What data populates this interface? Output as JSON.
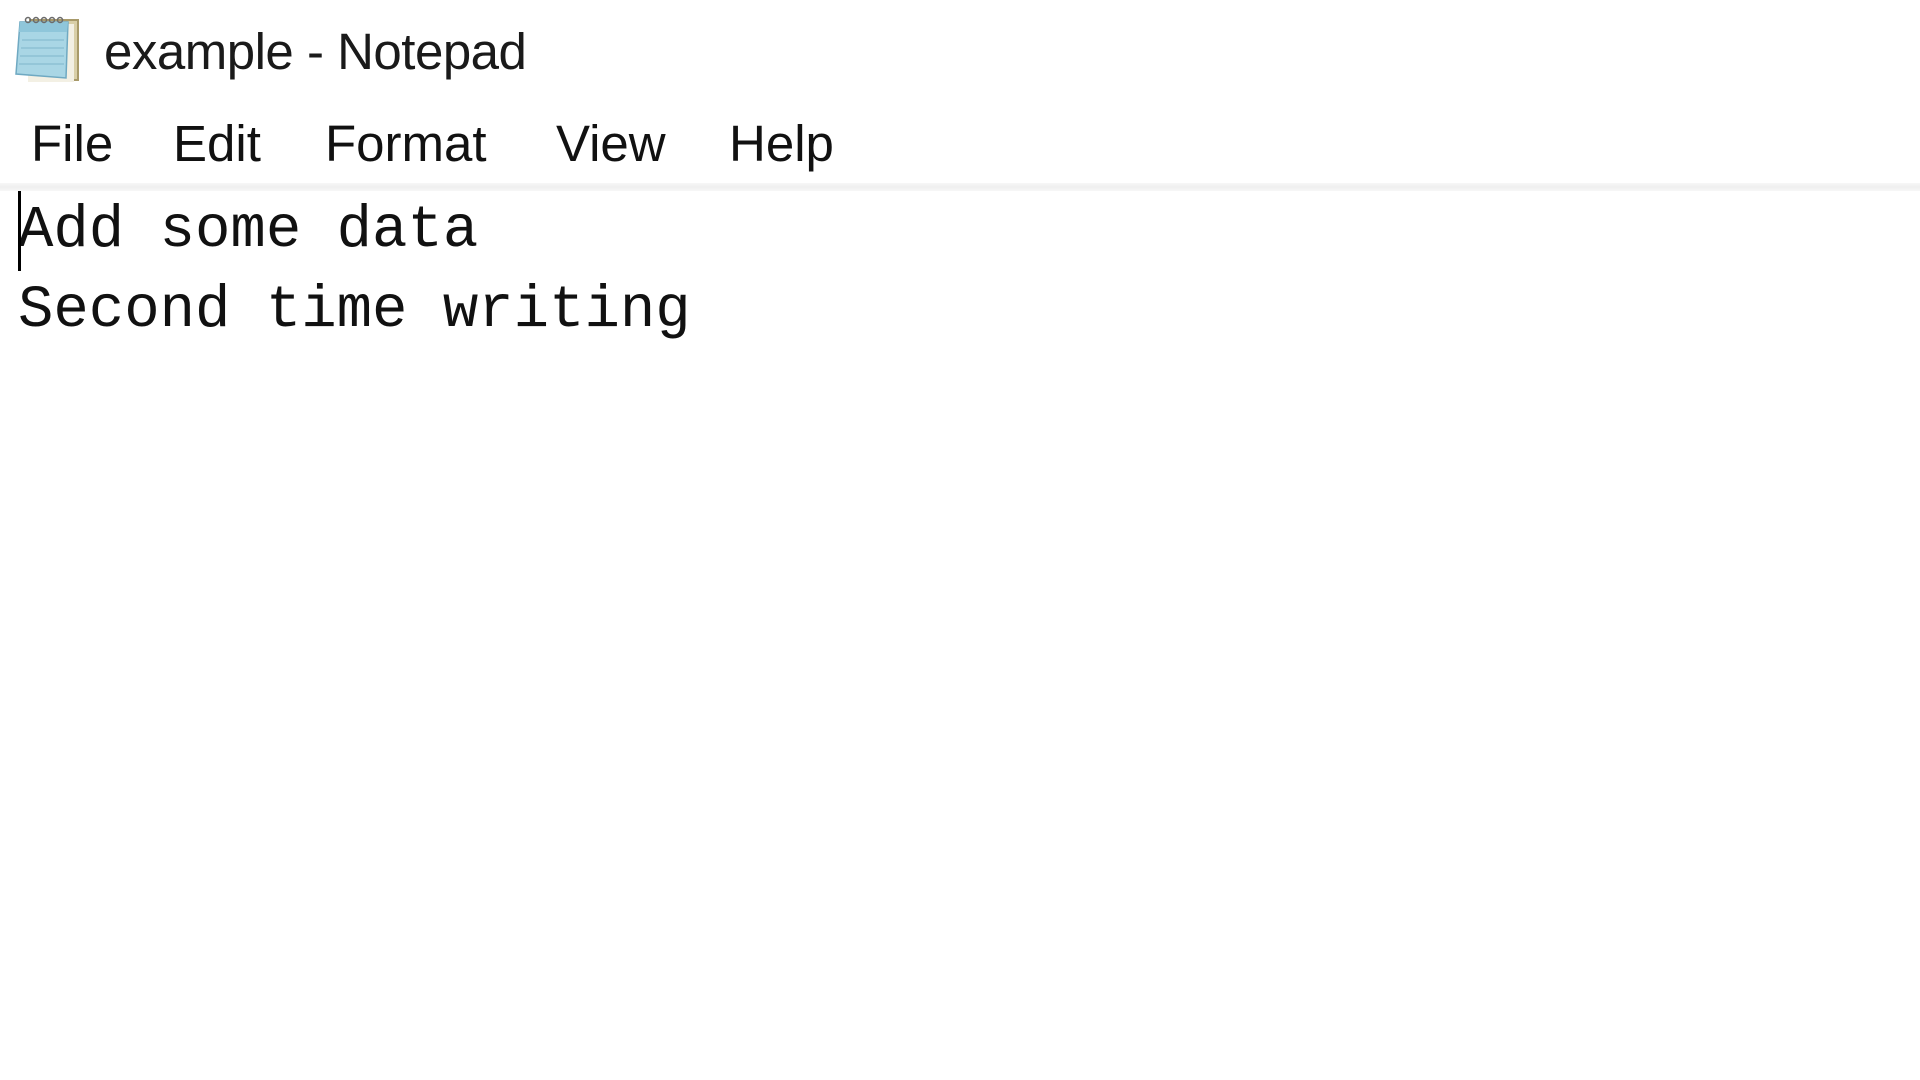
{
  "window": {
    "title": "example - Notepad",
    "app_icon": "notepad-icon"
  },
  "menubar": {
    "items": [
      {
        "label": "File"
      },
      {
        "label": "Edit"
      },
      {
        "label": "Format"
      },
      {
        "label": "View"
      },
      {
        "label": "Help"
      }
    ]
  },
  "editor": {
    "lines": [
      "Add some data",
      "Second time writing"
    ],
    "caret": {
      "line": 1,
      "column": 1
    }
  },
  "colors": {
    "background": "#ffffff",
    "text": "#111111",
    "separator": "#efefef",
    "icon_page": "#a9d6e5",
    "icon_back": "#c8b98a"
  }
}
